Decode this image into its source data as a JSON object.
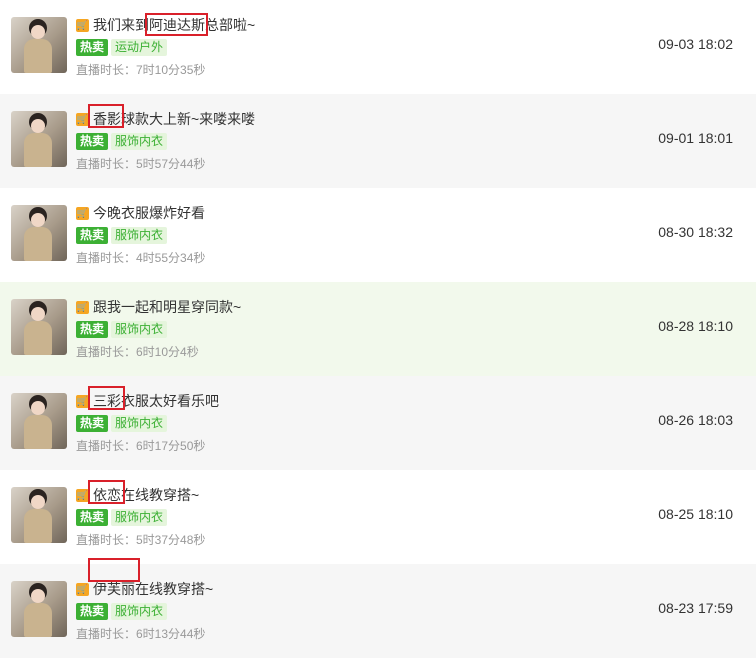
{
  "items": [
    {
      "title": "我们来到阿迪达斯总部啦~",
      "hot_label": "热卖",
      "category": "运动户外",
      "duration": "直播时长：7时10分35秒",
      "time": "09-03 18:02"
    },
    {
      "title": "香影球款大上新~来喽来喽",
      "hot_label": "热卖",
      "category": "服饰内衣",
      "duration": "直播时长：5时57分44秒",
      "time": "09-01 18:01"
    },
    {
      "title": "今晚衣服爆炸好看",
      "hot_label": "热卖",
      "category": "服饰内衣",
      "duration": "直播时长：4时55分34秒",
      "time": "08-30 18:32"
    },
    {
      "title": "跟我一起和明星穿同款~",
      "hot_label": "热卖",
      "category": "服饰内衣",
      "duration": "直播时长：6时10分4秒",
      "time": "08-28 18:10"
    },
    {
      "title": "三彩衣服太好看乐吧",
      "hot_label": "热卖",
      "category": "服饰内衣",
      "duration": "直播时长：6时17分50秒",
      "time": "08-26 18:03"
    },
    {
      "title": "依恋在线教穿搭~",
      "hot_label": "热卖",
      "category": "服饰内衣",
      "duration": "直播时长：5时37分48秒",
      "time": "08-25 18:10"
    },
    {
      "title": "伊芙丽在线教穿搭~",
      "hot_label": "热卖",
      "category": "服饰内衣",
      "duration": "直播时长：6时13分44秒",
      "time": "08-23 17:59"
    }
  ],
  "colors": {
    "hot_tag": "#3cb034",
    "category_tag_bg": "#e5f5dc",
    "highlight_box": "#d9202a",
    "cart_icon": "#f5a623"
  },
  "icons": {
    "cart": "cart-icon"
  }
}
